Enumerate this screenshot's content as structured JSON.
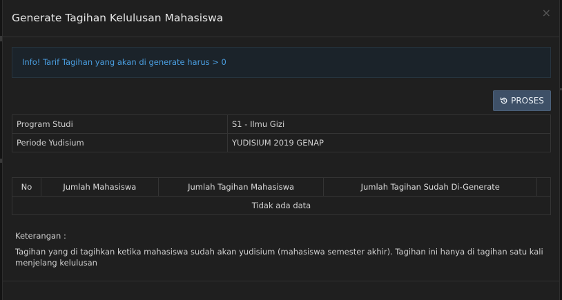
{
  "modal": {
    "title": "Generate Tagihan Kelulusan Mahasiswa",
    "close_label": "×"
  },
  "alert": {
    "text": "Info! Tarif Tagihan yang akan di generate harus > 0"
  },
  "proses_button": {
    "label": "PROSES",
    "icon": "history-icon"
  },
  "info_table": {
    "rows": [
      {
        "key": "Program Studi",
        "value": "S1 - Ilmu Gizi"
      },
      {
        "key": "Periode Yudisium",
        "value": "YUDISIUM 2019 GENAP"
      }
    ]
  },
  "data_table": {
    "headers": [
      "No",
      "Jumlah Mahasiswa",
      "Jumlah Tagihan Mahasiswa",
      "Jumlah Tagihan Sudah Di-Generate",
      ""
    ],
    "empty_text": "Tidak ada data"
  },
  "keterangan": {
    "label": "Keterangan :",
    "text": "Tagihan yang di tagihkan ketika mahasiswa sudah akan yudisium (mahasiswa semester akhir). Tagihan ini hanya di tagihan satu kali menjelang kelulusan"
  },
  "colors": {
    "accent_info": "#4a9ee0",
    "button_bg": "#3e5067"
  }
}
